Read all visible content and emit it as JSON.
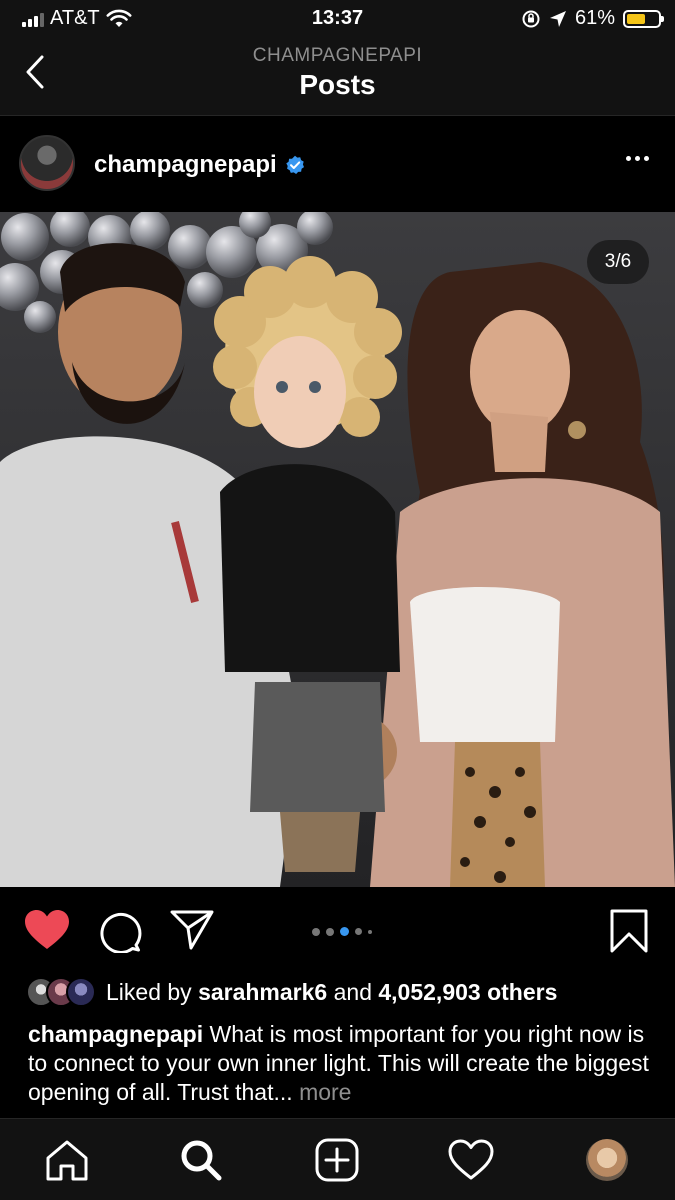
{
  "status_bar": {
    "carrier": "AT&T",
    "time": "13:37",
    "battery": "61%",
    "battery_level": 0.61,
    "icons": [
      "signal-icon",
      "wifi-icon",
      "orientation-lock-icon",
      "location-icon",
      "battery-icon"
    ]
  },
  "header": {
    "subtitle": "CHAMPAGNEPAPI",
    "title": "Posts"
  },
  "post": {
    "username": "champagnepapi",
    "verified": true,
    "counter": "3/6",
    "carousel_active_index": 2,
    "liked": true,
    "like_color": "#ed4956",
    "likes": {
      "prefix": "Liked by",
      "first_user": "sarahmark6",
      "middle": "and",
      "others": "4,052,903 others"
    },
    "caption": {
      "username": "champagnepapi",
      "text": "What is most important for you right now is to connect to your own inner light. This will create the biggest opening of all. Trust that...",
      "more": "more"
    }
  },
  "tab_bar": {
    "items": [
      "home-icon",
      "search-icon",
      "new-post-icon",
      "activity-icon",
      "profile-avatar"
    ]
  },
  "colors": {
    "background": "#000000",
    "bar": "#121212",
    "accent_blue": "#3897f0",
    "muted": "#8e8e8e"
  }
}
